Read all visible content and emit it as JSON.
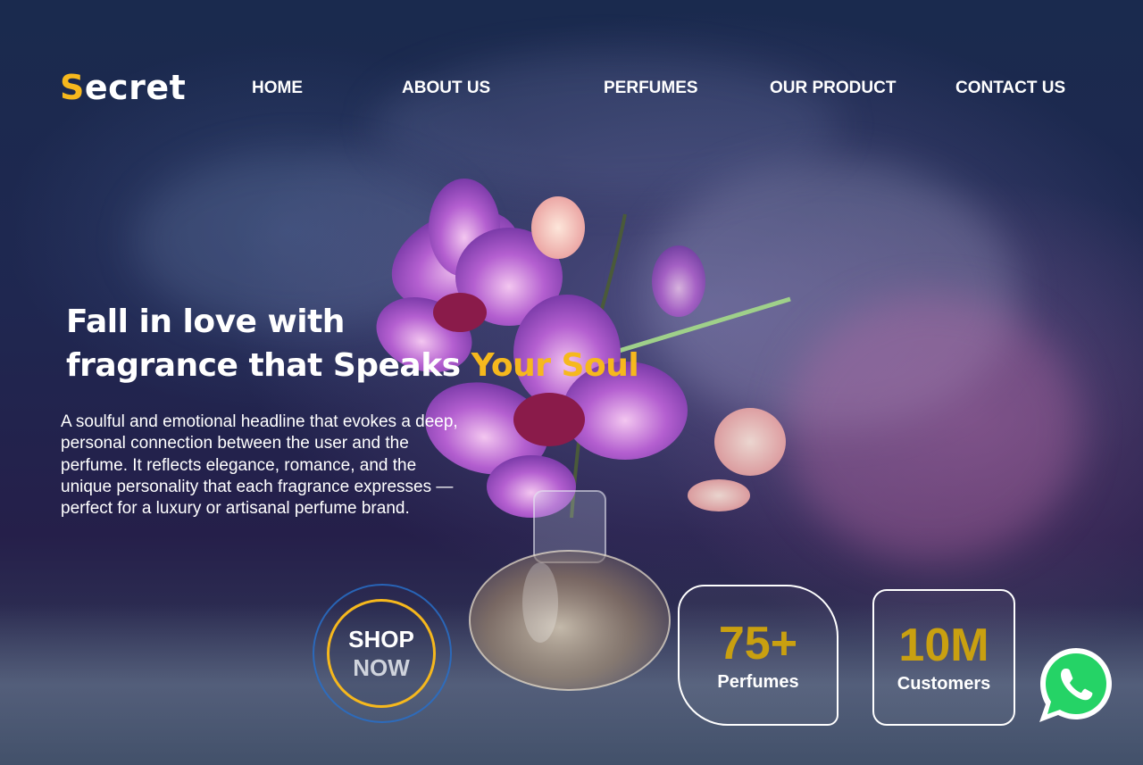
{
  "brand": {
    "first_letter": "S",
    "rest": "ecret"
  },
  "nav": {
    "home": "HOME",
    "about": "ABOUT US",
    "perfumes": "PERFUMES",
    "product": "OUR PRODUCT",
    "contact": "CONTACT US"
  },
  "hero": {
    "headline_line1": "Fall in love with",
    "headline_line2_plain": "fragrance that Speaks ",
    "headline_line2_accent": "Your Soul",
    "description": "A soulful and emotional headline that evokes a deep, personal connection between the user and the perfume. It reflects elegance, romance, and the unique personality that each fragrance expresses — perfect for a luxury or artisanal perfume brand."
  },
  "cta": {
    "line1": "SHOP",
    "line2": "NOW"
  },
  "stats": [
    {
      "value": "75+",
      "label": "Perfumes"
    },
    {
      "value": "10M",
      "label": "Customers"
    }
  ],
  "icons": {
    "whatsapp": "whatsapp-icon",
    "hero_image": "orchid-perfume-illustration"
  },
  "colors": {
    "accent": "#f6b81d",
    "stat_number": "#c9a010",
    "background": "#1d2648",
    "whatsapp_green": "#25d366"
  }
}
